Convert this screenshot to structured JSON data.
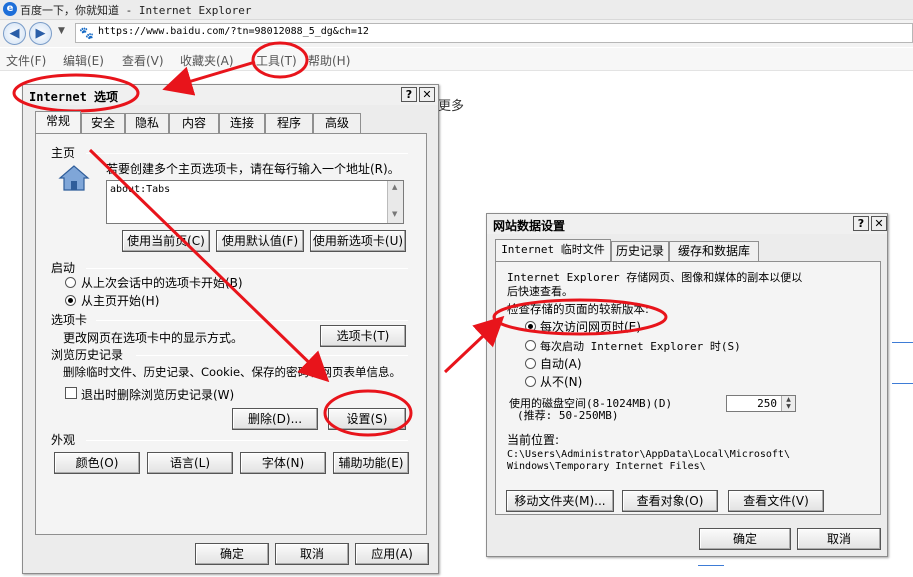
{
  "browser": {
    "title": "百度一下，你就知道 - Internet Explorer",
    "url": "https://www.baidu.com/?tn=98012088_5_dg&ch=12",
    "menus": [
      "文件(F)",
      "编辑(E)",
      "查看(V)",
      "收藏夹(A)",
      "工具(T)",
      "帮助(H)"
    ],
    "page_text": "更多"
  },
  "internet_options": {
    "title": "Internet 选项",
    "tabs": [
      "常规",
      "安全",
      "隐私",
      "内容",
      "连接",
      "程序",
      "高级"
    ],
    "home_page": {
      "group": "主页",
      "hint": "若要创建多个主页选项卡，请在每行输入一个地址(R)。",
      "value": "about:Tabs",
      "buttons": [
        "使用当前页(C)",
        "使用默认值(F)",
        "使用新选项卡(U)"
      ]
    },
    "startup": {
      "group": "启动",
      "options": [
        "从上次会话中的选项卡开始(B)",
        "从主页开始(H)"
      ],
      "selected": "从主页开始(H)"
    },
    "tabs_section": {
      "group": "选项卡",
      "text": "更改网页在选项卡中的显示方式。",
      "button": "选项卡(T)"
    },
    "history": {
      "group": "浏览历史记录",
      "text": "删除临时文件、历史记录、Cookie、保存的密码和网页表单信息。",
      "checkbox": "退出时删除浏览历史记录(W)",
      "delete_button": "删除(D)...",
      "settings_button": "设置(S)"
    },
    "appearance": {
      "group": "外观",
      "buttons": [
        "颜色(O)",
        "语言(L)",
        "字体(N)",
        "辅助功能(E)"
      ]
    },
    "footer": [
      "确定",
      "取消",
      "应用(A)"
    ]
  },
  "website_data": {
    "title": "网站数据设置",
    "tabs": [
      "Internet 临时文件",
      "历史记录",
      "缓存和数据库"
    ],
    "description": "Internet Explorer 存储网页、图像和媒体的副本以便以后快速查看。",
    "check_label": "检查存储的页面的较新版本:",
    "options": [
      "每次访问网页时(E)",
      "每次启动 Internet Explorer 时(S)",
      "自动(A)",
      "从不(N)"
    ],
    "selected": "每次访问网页时(E)",
    "disk_label": "使用的磁盘空间(8-1024MB)(D)",
    "disk_hint": "(推荐: 50-250MB)",
    "disk_value": "250",
    "location_label": "当前位置:",
    "location_path_1": "C:\\Users\\Administrator\\AppData\\Local\\Microsoft\\",
    "location_path_2": "Windows\\Temporary Internet Files\\",
    "buttons": [
      "移动文件夹(M)...",
      "查看对象(O)",
      "查看文件(V)"
    ],
    "footer": [
      "确定",
      "取消"
    ]
  },
  "colors": {
    "annotation": "#e8141b",
    "dialog_bg": "#ececec",
    "accent_blue": "#3e7cd6"
  }
}
